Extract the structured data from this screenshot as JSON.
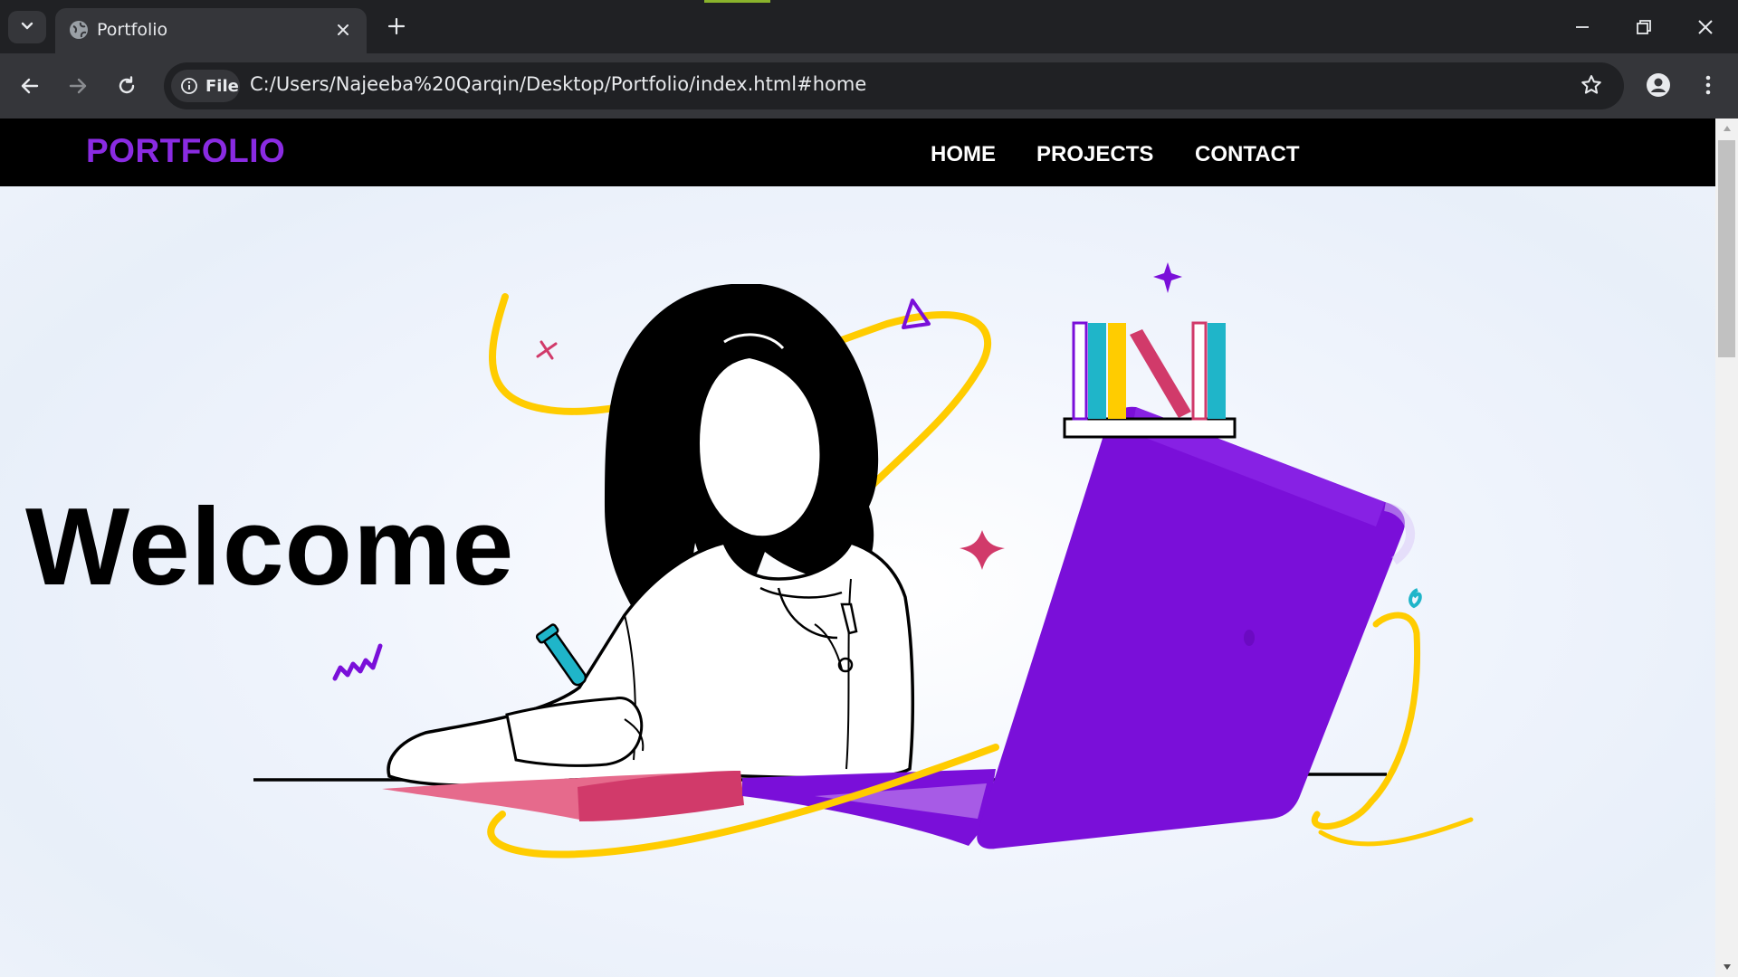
{
  "browser": {
    "tab_title": "Portfolio",
    "url_chip_label": "File",
    "url": "C:/Users/Najeeba%20Qarqin/Desktop/Portfolio/index.html#home",
    "icons": {
      "tab_search": "chevron-down-icon",
      "favicon": "globe-icon",
      "tab_close": "close-icon",
      "new_tab": "plus-icon",
      "minimize": "minimize-icon",
      "restore": "restore-icon",
      "close_window": "close-icon",
      "back": "arrow-left-icon",
      "forward": "arrow-right-icon",
      "reload": "reload-icon",
      "site_info": "info-icon",
      "bookmark": "star-icon",
      "profile": "person-icon",
      "menu": "kebab-icon"
    }
  },
  "site": {
    "brand": "PORTFOLIO",
    "brand_color": "#8a2be2",
    "nav": {
      "home": "HOME",
      "projects": "PROJECTS",
      "contact": "CONTACT"
    },
    "hero": {
      "heading": "Welcome",
      "illustration": "woman-writing-at-laptop-illustration"
    },
    "colors": {
      "laptop": "#7a0fd9",
      "notebook": "#d13a6a",
      "swoosh": "#ffcc00",
      "accent_teal": "#1fb5c9"
    }
  }
}
